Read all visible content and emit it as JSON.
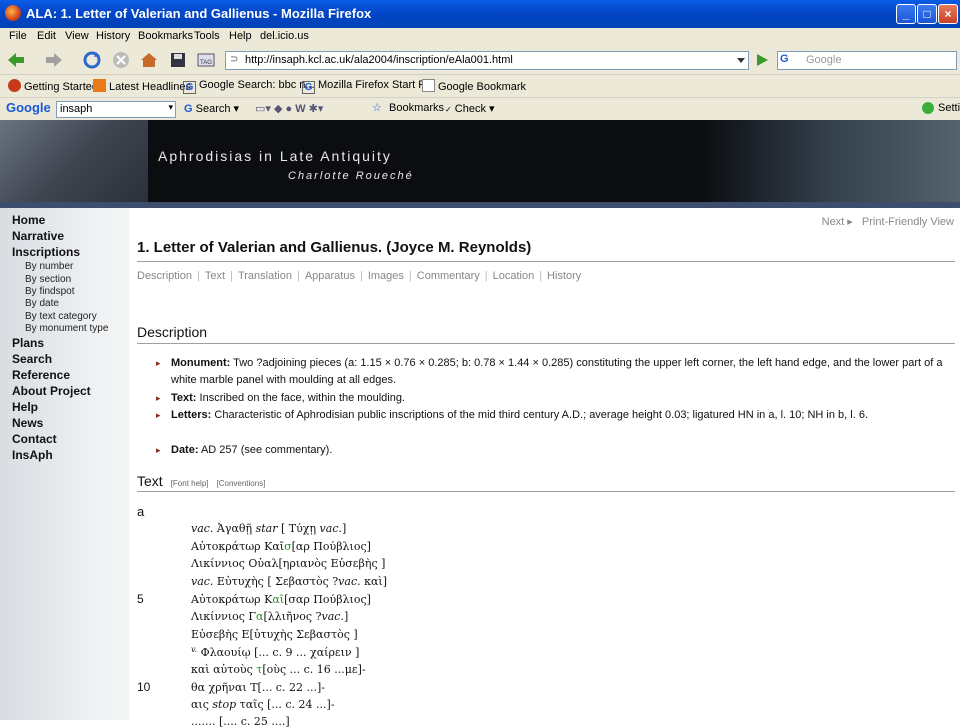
{
  "window": {
    "title": "ALA: 1. Letter of Valerian and Gallienus - Mozilla Firefox"
  },
  "menu": [
    "File",
    "Edit",
    "View",
    "History",
    "Bookmarks",
    "Tools",
    "Help",
    "del.icio.us"
  ],
  "nav": {
    "url": "http://insaph.kcl.ac.uk/ala2004/inscription/eAla001.html",
    "search_placeholder": "Google"
  },
  "bookmarks": [
    "Getting Started",
    "Latest Headlines",
    "Google Search: bbc n...",
    "Mozilla Firefox Start P...",
    "Google Bookmark"
  ],
  "google_toolbar": {
    "logo": "Google",
    "query": "insaph",
    "search": "Search",
    "bookmarks": "Bookmarks",
    "check": "Check",
    "settings": "Setti"
  },
  "banner": {
    "title": "Aphrodisias in Late Antiquity",
    "author": "Charlotte Roueché"
  },
  "sidebar": {
    "items": [
      "Home",
      "Narrative",
      "Inscriptions",
      "Plans",
      "Search",
      "Reference",
      "About Project",
      "Help",
      "News",
      "Contact",
      "InsAph"
    ],
    "subitems": [
      "By number",
      "By section",
      "By findspot",
      "By date",
      "By text category",
      "By monument type"
    ]
  },
  "page": {
    "next": "Next ▸",
    "print": "Print-Friendly View",
    "heading": "1. Letter of Valerian and Gallienus. (Joyce M. Reynolds)",
    "tabs": [
      "Description",
      "Text",
      "Translation",
      "Apparatus",
      "Images",
      "Commentary",
      "Location",
      "History"
    ],
    "description_heading": "Description",
    "bullets": [
      {
        "label": "Monument:",
        "text": "Two ?adjoining pieces (a: 1.15 × 0.76 × 0.285; b: 0.78 × 1.44 × 0.285) constituting the upper left corner, the left hand edge, and the lower part of a white marble panel with moulding at all edges."
      },
      {
        "label": "Text:",
        "text": "Inscribed on the face, within the moulding."
      },
      {
        "label": "Letters:",
        "text": "Characteristic of Aphrodisian public inscriptions of the mid third century A.D.; average height 0.03; ligatured HN in a, l. 10; NH in b, l. 6."
      },
      {
        "label": "Date:",
        "text": "AD 257 (see commentary)."
      }
    ],
    "text_heading": "Text",
    "font_help": "[Font help]",
    "conventions": "[Conventions]",
    "fragment": "a",
    "line5": "5",
    "line10": "10"
  }
}
